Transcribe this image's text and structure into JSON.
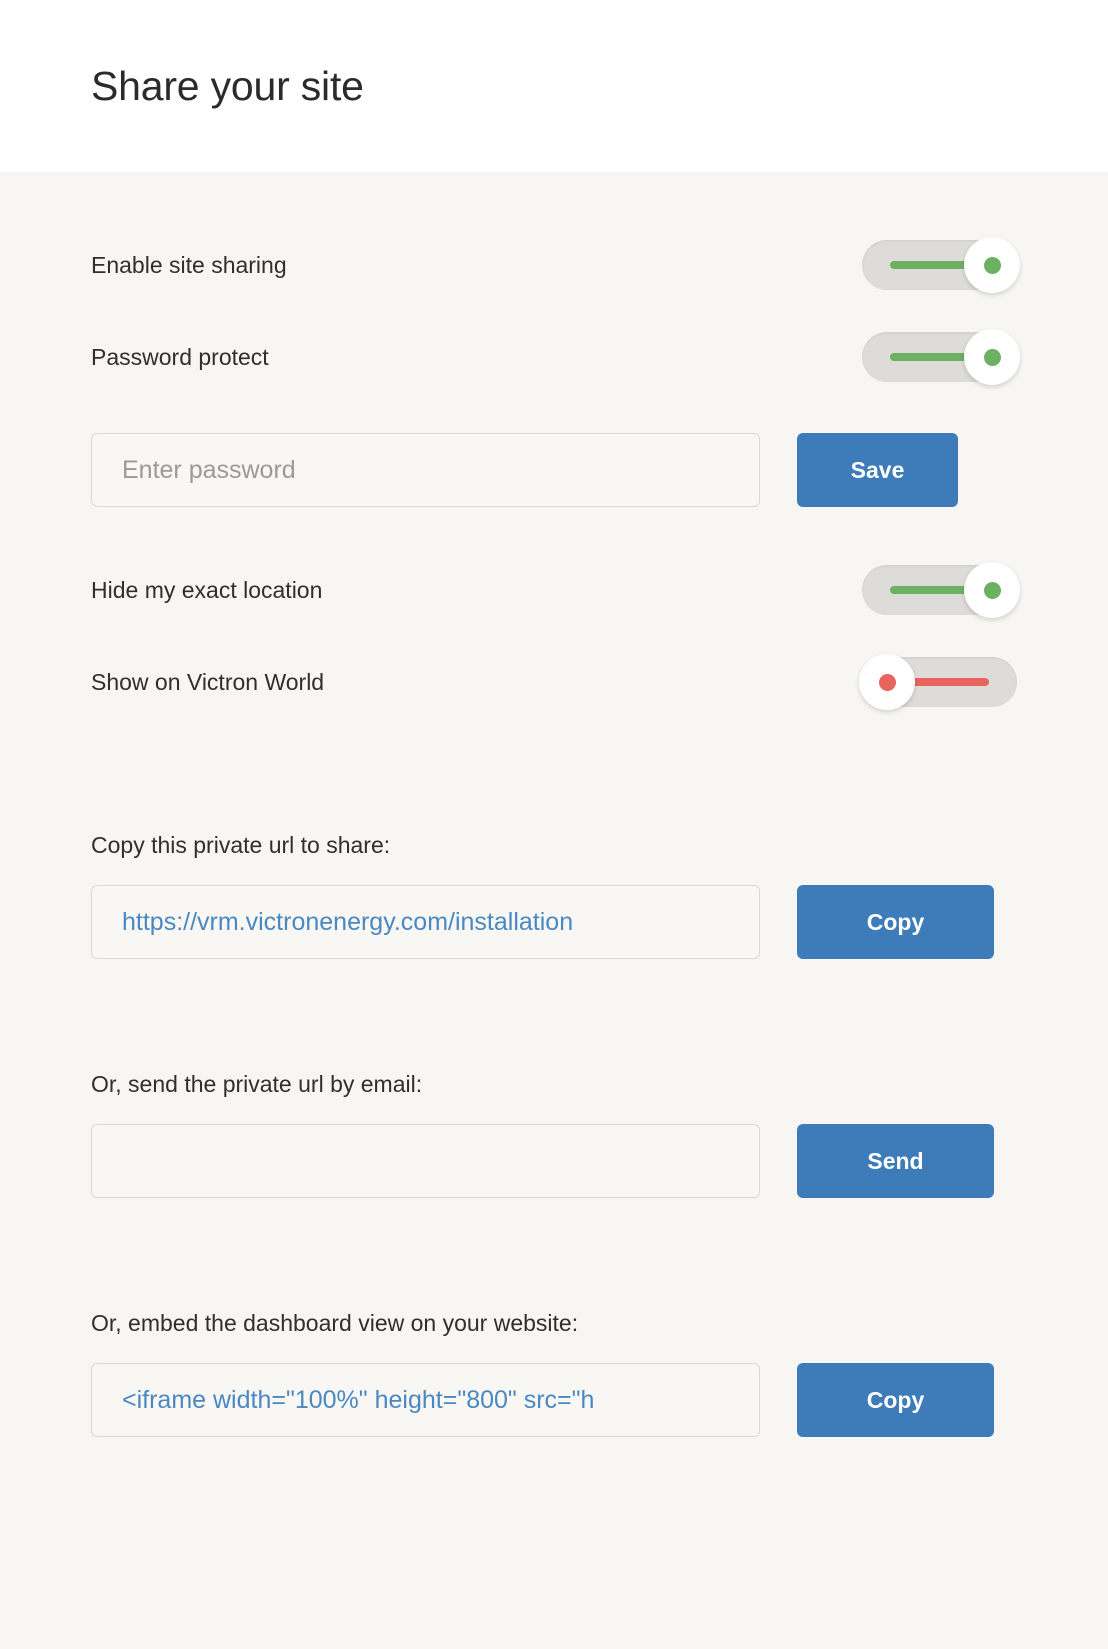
{
  "header": {
    "title": "Share your site"
  },
  "settings": {
    "rows": [
      {
        "label": "Enable site sharing",
        "state": "on",
        "toggle_name": "toggle-enable-site-sharing"
      },
      {
        "label": "Password protect",
        "state": "on",
        "toggle_name": "toggle-password-protect"
      },
      {
        "label": "Hide my exact location",
        "state": "on",
        "toggle_name": "toggle-hide-exact-location"
      },
      {
        "label": "Show on Victron World",
        "state": "off",
        "toggle_name": "toggle-show-on-victron-world"
      }
    ]
  },
  "password": {
    "placeholder": "Enter password",
    "value": "",
    "save_label": "Save"
  },
  "share_url": {
    "label": "Copy this private url to share:",
    "value": "https://vrm.victronenergy.com/installation",
    "copy_label": "Copy"
  },
  "email": {
    "label": "Or, send the private url by email:",
    "value": "",
    "placeholder": "",
    "send_label": "Send"
  },
  "embed": {
    "label": "Or, embed the dashboard view on your website:",
    "value": "<iframe width=\"100%\" height=\"800\" src=\"h",
    "copy_label": "Copy"
  },
  "colors": {
    "accent_blue": "#3d7cb8",
    "toggle_on_green": "#6cb162",
    "toggle_off_red": "#e8645f",
    "link_blue": "#4a88c2",
    "page_background": "#f7f6f2",
    "header_background": "#ffffff"
  }
}
